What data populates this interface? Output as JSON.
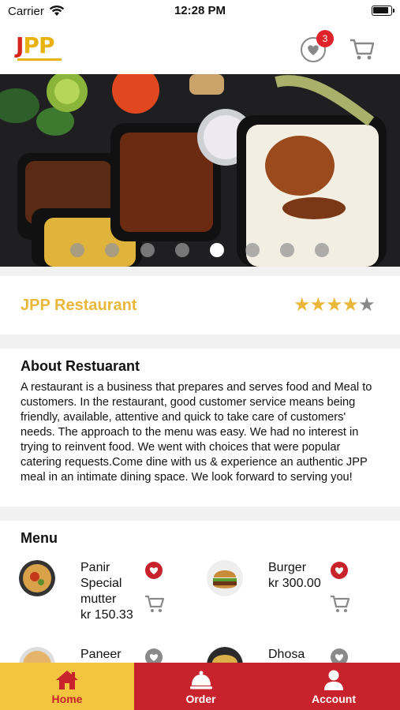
{
  "status_bar": {
    "carrier": "Carrier",
    "time": "12:28 PM"
  },
  "header": {
    "logo_text_j": "J",
    "logo_text_pp": "PP",
    "favorites_count": "3"
  },
  "carousel": {
    "slide_count": 8,
    "active_index": 4
  },
  "restaurant": {
    "name": "JPP Restaurant",
    "rating": 4,
    "rating_max": 5
  },
  "about": {
    "title": "About Restuarant",
    "body": "A restaurant is a business that prepares and serves food and Meal to customers. In the restaurant, good customer service means being friendly, available, attentive and quick to take care of customers' needs. The approach to the menu was easy. We had no interest in trying to reinvent food. We went with choices that were popular catering requests.Come dine with us & experience an authentic JPP meal in an intimate dining space. We look forward to serving you!"
  },
  "menu": {
    "title": "Menu",
    "items": [
      {
        "name": "Panir Special mutter",
        "price": "kr 150.33",
        "favorited": true
      },
      {
        "name": "Burger",
        "price": "kr 300.00",
        "favorited": true
      },
      {
        "name": "Paneer",
        "price": "",
        "favorited": false
      },
      {
        "name": "Dhosa",
        "price": "",
        "favorited": false
      }
    ]
  },
  "tabs": [
    {
      "label": "Home",
      "active": true
    },
    {
      "label": "Order",
      "active": false
    },
    {
      "label": "Account",
      "active": false
    }
  ],
  "colors": {
    "accent_yellow": "#f2c440",
    "accent_red": "#c8232c",
    "star": "#e9b73a"
  }
}
